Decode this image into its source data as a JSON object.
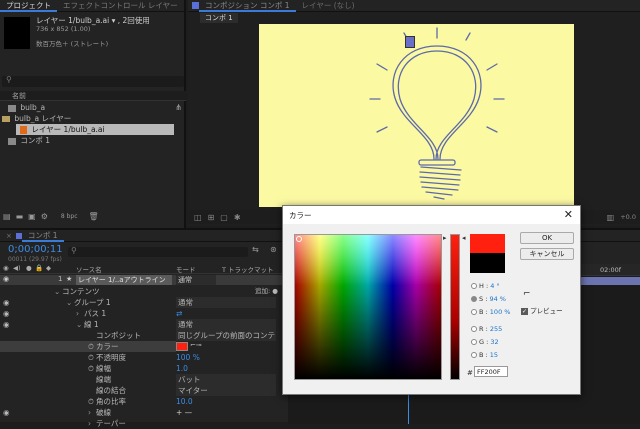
{
  "project_panel": {
    "tabs": [
      "プロジェクト",
      "エフェクトコントロール レイヤー"
    ],
    "layer_title": "レイヤー 1/bulb_a.ai ▾ , 2回使用",
    "size": "736 x 852 (1.00)",
    "color_info": "数百万色＋ (ストレート)",
    "search_placeholder": "",
    "name_header": "名前",
    "items": [
      "bulb_a",
      "bulb_a レイヤー",
      "レイヤー 1/bulb_a.ai",
      "コンポ 1"
    ],
    "bpc": "8 bpc"
  },
  "comp_panel": {
    "tabs": [
      "コンポジション コンポ 1",
      "レイヤー (なし)"
    ],
    "breadcrumb": "コンポ 1",
    "bg_color": "#fcf9a3",
    "zoom_label": "+0.0"
  },
  "timeline": {
    "tab": "コンポ 1",
    "timecode": "0;00;00;11",
    "timecode_sub": "00011 (29.97 fps)",
    "search_placeholder": "",
    "headers": {
      "source": "ソース名",
      "mode": "モード",
      "trackmatte": "T トラックマット"
    },
    "layer_num": "1",
    "layer_name": "レイヤー 1/..aアウトライン",
    "layer_mode": "通常",
    "rows": [
      {
        "label": "コンテンツ",
        "value": "",
        "extra": "追加: ●"
      },
      {
        "label": "グループ 1",
        "value": "通常",
        "extra": ""
      },
      {
        "label": "パス 1",
        "value": "",
        "extra": ""
      },
      {
        "label": "線 1",
        "value": "通常",
        "extra": ""
      },
      {
        "label": "コンポジット",
        "value": "同じグループの前面のコンテン",
        "extra": ""
      },
      {
        "label": "カラー",
        "value": "",
        "extra": ""
      },
      {
        "label": "不透明度",
        "value": "100 %",
        "extra": ""
      },
      {
        "label": "線幅",
        "value": "1.0",
        "extra": ""
      },
      {
        "label": "線端",
        "value": "バット",
        "extra": ""
      },
      {
        "label": "線の結合",
        "value": "マイター",
        "extra": ""
      },
      {
        "label": "角の比率",
        "value": "10.0",
        "extra": ""
      },
      {
        "label": "破線",
        "value": "+ —",
        "extra": ""
      },
      {
        "label": "テーパー",
        "value": "",
        "extra": ""
      }
    ],
    "ruler_label": "02:00f"
  },
  "color_dialog": {
    "title": "カラー",
    "ok_label": "OK",
    "cancel_label": "キャンセル",
    "h_label": "H :",
    "h_value": "4 °",
    "s_label": "S :",
    "s_value": "94 %",
    "b_label": "B :",
    "b_value": "100 %",
    "r_label": "R :",
    "r_value": "255",
    "g_label": "G :",
    "g_value": "32",
    "bl_label": "B :",
    "bl_value": "15",
    "hex_prefix": "#",
    "hex_value": "FF200F",
    "preview_label": "プレビュー",
    "new_color": "#ff200f",
    "old_color": "#000000"
  }
}
